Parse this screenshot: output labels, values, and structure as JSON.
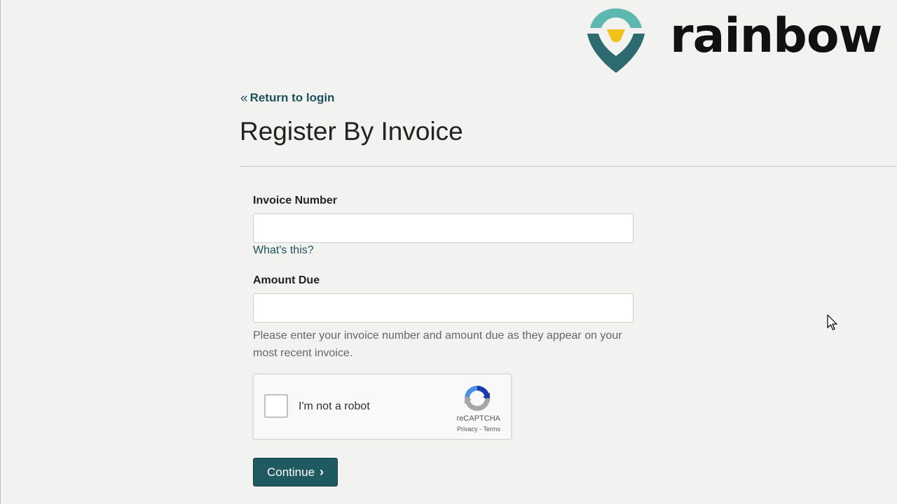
{
  "brand": {
    "name": "rainbow",
    "colors": {
      "teal": "#2d6b70",
      "light_teal": "#5fb8b0",
      "yellow": "#f2c21b"
    }
  },
  "nav": {
    "return_label": "Return to login",
    "return_icon": "double-chevron-left-icon"
  },
  "page": {
    "title": "Register By Invoice"
  },
  "form": {
    "invoice_number": {
      "label": "Invoice Number",
      "value": "",
      "placeholder": "",
      "help_link": "What's this?"
    },
    "amount_due": {
      "label": "Amount Due",
      "value": "",
      "placeholder": ""
    },
    "help_text": "Please enter your invoice number and amount due as they appear on your most recent invoice."
  },
  "recaptcha": {
    "label": "I'm not a robot",
    "brand": "reCAPTCHA",
    "privacy": "Privacy",
    "separator": " - ",
    "terms": "Terms"
  },
  "actions": {
    "continue_label": "Continue",
    "continue_icon": "chevron-right-icon",
    "accent": "#1f5a60"
  }
}
